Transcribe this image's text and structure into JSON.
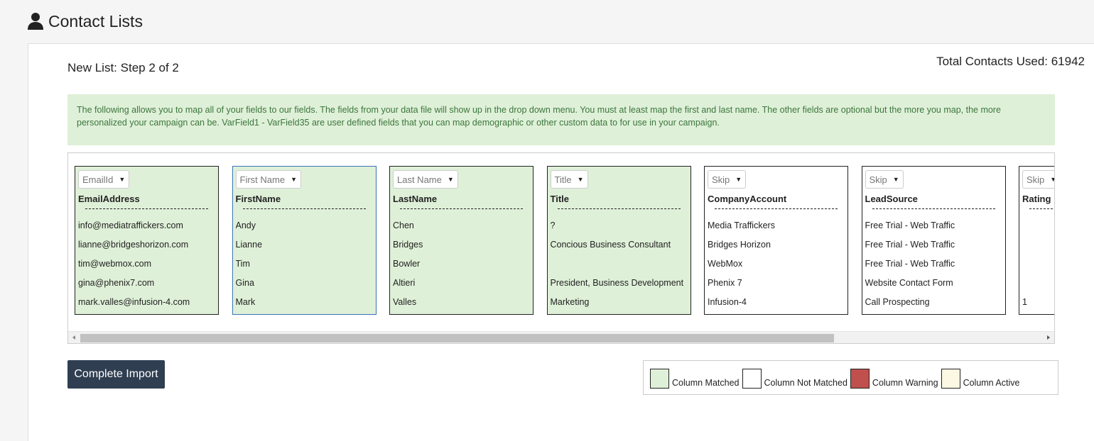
{
  "page": {
    "title": "Contact Lists",
    "icon": "user-icon"
  },
  "step_title": "New List: Step 2 of 2",
  "total_contacts": "Total Contacts Used: 61942",
  "info": "The following allows you to map all of your fields to our fields. The fields from your data file will show up in the drop down menu. You must at least map the first and last name. The other fields are optional but the more you map, the more personalized your campaign can be. VarField1 - VarField35 are user defined fields that you can map demographic or other custom data to for use in your campaign.",
  "columns": [
    {
      "select": "EmailId",
      "name": "EmailAddress",
      "status": "matched",
      "cells": [
        "info@mediatraffickers.com",
        "lianne@bridgeshorizon.com",
        "tim@webmox.com",
        "gina@phenix7.com",
        "mark.valles@infusion-4.com"
      ]
    },
    {
      "select": "First Name",
      "name": "FirstName",
      "status": "matched",
      "cells": [
        "Andy",
        "Lianne",
        "Tim",
        "Gina",
        "Mark"
      ]
    },
    {
      "select": "Last Name",
      "name": "LastName",
      "status": "matched",
      "cells": [
        "Chen",
        "Bridges",
        "Bowler",
        "Altieri",
        "Valles"
      ]
    },
    {
      "select": "Title",
      "name": "Title",
      "status": "matched",
      "cells": [
        "?",
        "Concious Business Consultant",
        "",
        "President, Business Development",
        "Marketing"
      ]
    },
    {
      "select": "Skip",
      "name": "CompanyAccount",
      "status": "not_matched",
      "cells": [
        "Media Traffickers",
        "Bridges Horizon",
        "WebMox",
        "Phenix 7",
        "Infusion-4"
      ]
    },
    {
      "select": "Skip",
      "name": "LeadSource",
      "status": "not_matched",
      "cells": [
        "Free Trial - Web Traffic",
        "Free Trial - Web Traffic",
        "Free Trial - Web Traffic",
        "Website Contact Form",
        "Call Prospecting"
      ]
    },
    {
      "select": "Skip",
      "name": "Rating",
      "status": "not_matched",
      "cells": [
        "",
        "",
        "",
        "",
        "1"
      ]
    }
  ],
  "complete_button": "Complete Import",
  "legend": [
    {
      "label": "Column Matched",
      "color": "#dff0d8"
    },
    {
      "label": "Column Not Matched",
      "color": "#ffffff"
    },
    {
      "label": "Column Warning",
      "color": "#c0504d"
    },
    {
      "label": "Column Active",
      "color": "#fcf8e3"
    }
  ]
}
